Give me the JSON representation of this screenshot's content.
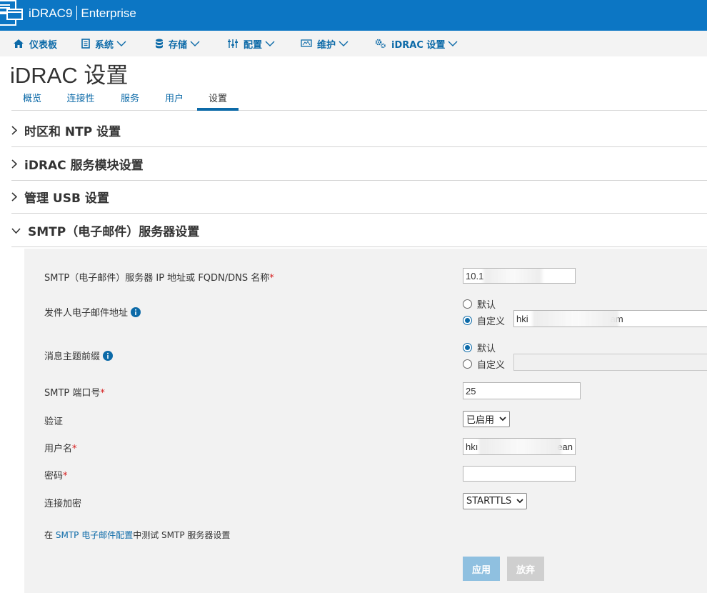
{
  "header": {
    "product": "iDRAC9",
    "edition": "Enterprise"
  },
  "nav": [
    {
      "label": "仪表板",
      "icon": "home-icon"
    },
    {
      "label": "系统",
      "icon": "server-icon"
    },
    {
      "label": "存储",
      "icon": "database-icon"
    },
    {
      "label": "配置",
      "icon": "sliders-icon"
    },
    {
      "label": "维护",
      "icon": "monitor-icon"
    },
    {
      "label": "iDRAC 设置",
      "icon": "gears-icon"
    }
  ],
  "page": {
    "title": "iDRAC 设置"
  },
  "tabs": [
    {
      "label": "概览"
    },
    {
      "label": "连接性"
    },
    {
      "label": "服务"
    },
    {
      "label": "用户"
    },
    {
      "label": "设置"
    }
  ],
  "sections": [
    {
      "label": "时区和 NTP 设置"
    },
    {
      "label": "iDRAC 服务模块设置"
    },
    {
      "label": "管理 USB 设置"
    },
    {
      "label": "SMTP（电子邮件）服务器设置"
    }
  ],
  "smtp": {
    "server_label": "SMTP（电子邮件）服务器 IP 地址或 FQDN/DNS 名称",
    "server_value": "10.1",
    "sender_label": "发件人电子邮件地址",
    "sender_default": "默认",
    "sender_custom": "自定义",
    "sender_value_start": "hki",
    "sender_value_end": "am",
    "subject_label": "消息主题前缀",
    "subject_default": "默认",
    "subject_custom": "自定义",
    "subject_value": "",
    "port_label": "SMTP 端口号",
    "port_value": "25",
    "auth_label": "验证",
    "auth_value": "已启用",
    "username_label": "用户名",
    "username_start": "hkı",
    "username_end": "ean",
    "password_label": "密码",
    "password_value": "",
    "encrypt_label": "连接加密",
    "encrypt_value": "STARTTLS",
    "required_mark": "*"
  },
  "footnote": {
    "prefix": "在",
    "link": "SMTP 电子邮件配置",
    "suffix": "中测试 SMTP 服务器设置"
  },
  "buttons": {
    "apply": "应用",
    "discard": "放弃"
  },
  "colors": {
    "header_bg": "#0c76c4",
    "link": "#0c6aa8",
    "panel_bg": "#f2f2f2",
    "apply_bg": "#8fc0e0",
    "discard_bg": "#cfcfcf"
  }
}
